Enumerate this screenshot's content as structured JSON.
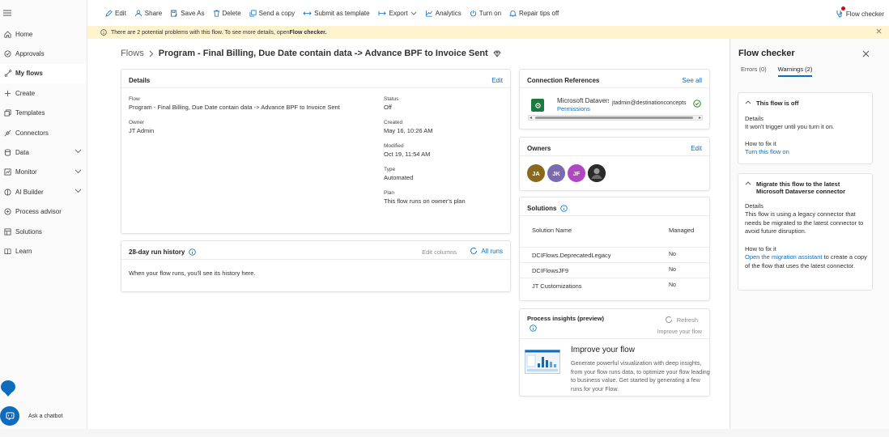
{
  "sidebar": {
    "items": [
      {
        "label": "Home",
        "icon": "home-icon"
      },
      {
        "label": "Approvals",
        "icon": "approvals-icon"
      },
      {
        "label": "My flows",
        "icon": "flows-icon",
        "active": true
      },
      {
        "label": "Create",
        "icon": "plus-icon"
      },
      {
        "label": "Templates",
        "icon": "templates-icon"
      },
      {
        "label": "Connectors",
        "icon": "connectors-icon"
      },
      {
        "label": "Data",
        "icon": "data-icon",
        "expandable": true
      },
      {
        "label": "Monitor",
        "icon": "monitor-icon",
        "expandable": true
      },
      {
        "label": "AI Builder",
        "icon": "ai-builder-icon",
        "expandable": true
      },
      {
        "label": "Process advisor",
        "icon": "process-advisor-icon"
      },
      {
        "label": "Solutions",
        "icon": "solutions-icon"
      },
      {
        "label": "Learn",
        "icon": "learn-icon"
      }
    ],
    "chatbot_label": "Ask a chatbot"
  },
  "toolbar": {
    "edit": "Edit",
    "share": "Share",
    "save_as": "Save As",
    "delete": "Delete",
    "send_copy": "Send a copy",
    "submit_template": "Submit as template",
    "export": "Export",
    "analytics": "Analytics",
    "turn_on": "Turn on",
    "repair_tips": "Repair tips off",
    "flow_checker": "Flow checker"
  },
  "banner": {
    "text": "There are 2 potential problems with this flow. To see more details, open ",
    "bold": "Flow checker."
  },
  "breadcrumb": {
    "root": "Flows",
    "title": "Program - Final Billing, Due Date contain data -> Advance BPF to Invoice Sent"
  },
  "details": {
    "title": "Details",
    "edit": "Edit",
    "flow_label": "Flow",
    "flow_value": "Program - Final Billing, Due Date contain data -> Advance BPF to Invoice Sent",
    "owner_label": "Owner",
    "owner_value": "JT Admin",
    "status_label": "Status",
    "status_value": "Off",
    "created_label": "Created",
    "created_value": "May 16, 10:26 AM",
    "modified_label": "Modified",
    "modified_value": "Oct 19, 11:54 AM",
    "type_label": "Type",
    "type_value": "Automated",
    "plan_label": "Plan",
    "plan_value": "This flow runs on owner's plan"
  },
  "run_history": {
    "title": "28-day run history",
    "edit_columns": "Edit columns",
    "all_runs": "All runs",
    "empty": "When your flow runs, you'll see its history here."
  },
  "connections": {
    "title": "Connection References",
    "see_all": "See all",
    "name": "Microsoft Dataverse",
    "permissions": "Permissions",
    "email": "jtadmin@destinationconcepts"
  },
  "owners": {
    "title": "Owners",
    "edit": "Edit",
    "avatars": [
      {
        "initials": "JA",
        "color": "#8a6a1a"
      },
      {
        "initials": "JK",
        "color": "#7b6ab0"
      },
      {
        "initials": "JF",
        "color": "#b146c2"
      },
      {
        "initials": "",
        "color": "#2b2b2b"
      }
    ]
  },
  "solutions": {
    "title": "Solutions",
    "col_name": "Solution Name",
    "col_managed": "Managed",
    "rows": [
      {
        "name": "DCIFlows.DeprecatedLegacy",
        "managed": "No"
      },
      {
        "name": "DCIFlowsJF9",
        "managed": "No"
      },
      {
        "name": "JT Customizations",
        "managed": "No"
      }
    ]
  },
  "insights": {
    "title": "Process insights (preview)",
    "refresh": "Refresh",
    "improve_link": "Improve your flow",
    "heading": "Improve your flow",
    "body": "Generate powerful visualization with deep insights, from your flow runs data, to optimize your flow leading to business value. Get started by generating a few runs for your Flow."
  },
  "checker": {
    "title": "Flow checker",
    "tab_errors": "Errors (0)",
    "tab_warnings": "Warnings (2)",
    "w1": {
      "title": "This flow is off",
      "details_label": "Details",
      "details": "It won't trigger until you turn it on.",
      "fix_label": "How to fix it",
      "fix_link": "Turn this flow on"
    },
    "w2": {
      "title": "Migrate this flow to the latest Microsoft Dataverse connector",
      "details_label": "Details",
      "details": "This flow is using a legacy connector that needs be migrated to the latest connector to avoid future disruption.",
      "fix_label": "How to fix it",
      "fix_link": "Open the migration assistant",
      "fix_rest": " to create a copy of the flow that uses the latest connector."
    }
  },
  "colors": {
    "accent": "#0f6cbd",
    "banner": "#fff4ce",
    "success": "#107c10"
  }
}
